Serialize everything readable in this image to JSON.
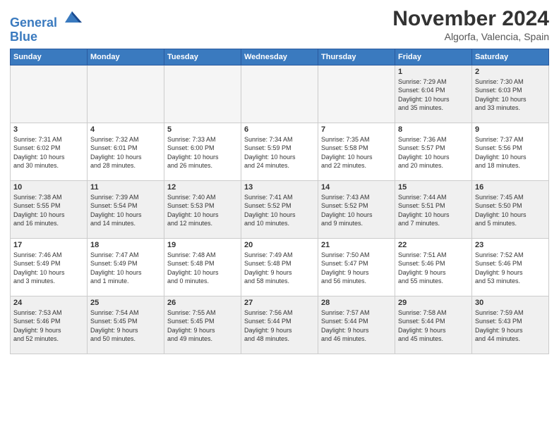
{
  "header": {
    "logo_line1": "General",
    "logo_line2": "Blue",
    "month": "November 2024",
    "location": "Algorfa, Valencia, Spain"
  },
  "weekdays": [
    "Sunday",
    "Monday",
    "Tuesday",
    "Wednesday",
    "Thursday",
    "Friday",
    "Saturday"
  ],
  "weeks": [
    [
      {
        "day": "",
        "info": ""
      },
      {
        "day": "",
        "info": ""
      },
      {
        "day": "",
        "info": ""
      },
      {
        "day": "",
        "info": ""
      },
      {
        "day": "",
        "info": ""
      },
      {
        "day": "1",
        "info": "Sunrise: 7:29 AM\nSunset: 6:04 PM\nDaylight: 10 hours\nand 35 minutes."
      },
      {
        "day": "2",
        "info": "Sunrise: 7:30 AM\nSunset: 6:03 PM\nDaylight: 10 hours\nand 33 minutes."
      }
    ],
    [
      {
        "day": "3",
        "info": "Sunrise: 7:31 AM\nSunset: 6:02 PM\nDaylight: 10 hours\nand 30 minutes."
      },
      {
        "day": "4",
        "info": "Sunrise: 7:32 AM\nSunset: 6:01 PM\nDaylight: 10 hours\nand 28 minutes."
      },
      {
        "day": "5",
        "info": "Sunrise: 7:33 AM\nSunset: 6:00 PM\nDaylight: 10 hours\nand 26 minutes."
      },
      {
        "day": "6",
        "info": "Sunrise: 7:34 AM\nSunset: 5:59 PM\nDaylight: 10 hours\nand 24 minutes."
      },
      {
        "day": "7",
        "info": "Sunrise: 7:35 AM\nSunset: 5:58 PM\nDaylight: 10 hours\nand 22 minutes."
      },
      {
        "day": "8",
        "info": "Sunrise: 7:36 AM\nSunset: 5:57 PM\nDaylight: 10 hours\nand 20 minutes."
      },
      {
        "day": "9",
        "info": "Sunrise: 7:37 AM\nSunset: 5:56 PM\nDaylight: 10 hours\nand 18 minutes."
      }
    ],
    [
      {
        "day": "10",
        "info": "Sunrise: 7:38 AM\nSunset: 5:55 PM\nDaylight: 10 hours\nand 16 minutes."
      },
      {
        "day": "11",
        "info": "Sunrise: 7:39 AM\nSunset: 5:54 PM\nDaylight: 10 hours\nand 14 minutes."
      },
      {
        "day": "12",
        "info": "Sunrise: 7:40 AM\nSunset: 5:53 PM\nDaylight: 10 hours\nand 12 minutes."
      },
      {
        "day": "13",
        "info": "Sunrise: 7:41 AM\nSunset: 5:52 PM\nDaylight: 10 hours\nand 10 minutes."
      },
      {
        "day": "14",
        "info": "Sunrise: 7:43 AM\nSunset: 5:52 PM\nDaylight: 10 hours\nand 9 minutes."
      },
      {
        "day": "15",
        "info": "Sunrise: 7:44 AM\nSunset: 5:51 PM\nDaylight: 10 hours\nand 7 minutes."
      },
      {
        "day": "16",
        "info": "Sunrise: 7:45 AM\nSunset: 5:50 PM\nDaylight: 10 hours\nand 5 minutes."
      }
    ],
    [
      {
        "day": "17",
        "info": "Sunrise: 7:46 AM\nSunset: 5:49 PM\nDaylight: 10 hours\nand 3 minutes."
      },
      {
        "day": "18",
        "info": "Sunrise: 7:47 AM\nSunset: 5:49 PM\nDaylight: 10 hours\nand 1 minute."
      },
      {
        "day": "19",
        "info": "Sunrise: 7:48 AM\nSunset: 5:48 PM\nDaylight: 10 hours\nand 0 minutes."
      },
      {
        "day": "20",
        "info": "Sunrise: 7:49 AM\nSunset: 5:48 PM\nDaylight: 9 hours\nand 58 minutes."
      },
      {
        "day": "21",
        "info": "Sunrise: 7:50 AM\nSunset: 5:47 PM\nDaylight: 9 hours\nand 56 minutes."
      },
      {
        "day": "22",
        "info": "Sunrise: 7:51 AM\nSunset: 5:46 PM\nDaylight: 9 hours\nand 55 minutes."
      },
      {
        "day": "23",
        "info": "Sunrise: 7:52 AM\nSunset: 5:46 PM\nDaylight: 9 hours\nand 53 minutes."
      }
    ],
    [
      {
        "day": "24",
        "info": "Sunrise: 7:53 AM\nSunset: 5:46 PM\nDaylight: 9 hours\nand 52 minutes."
      },
      {
        "day": "25",
        "info": "Sunrise: 7:54 AM\nSunset: 5:45 PM\nDaylight: 9 hours\nand 50 minutes."
      },
      {
        "day": "26",
        "info": "Sunrise: 7:55 AM\nSunset: 5:45 PM\nDaylight: 9 hours\nand 49 minutes."
      },
      {
        "day": "27",
        "info": "Sunrise: 7:56 AM\nSunset: 5:44 PM\nDaylight: 9 hours\nand 48 minutes."
      },
      {
        "day": "28",
        "info": "Sunrise: 7:57 AM\nSunset: 5:44 PM\nDaylight: 9 hours\nand 46 minutes."
      },
      {
        "day": "29",
        "info": "Sunrise: 7:58 AM\nSunset: 5:44 PM\nDaylight: 9 hours\nand 45 minutes."
      },
      {
        "day": "30",
        "info": "Sunrise: 7:59 AM\nSunset: 5:43 PM\nDaylight: 9 hours\nand 44 minutes."
      }
    ]
  ]
}
